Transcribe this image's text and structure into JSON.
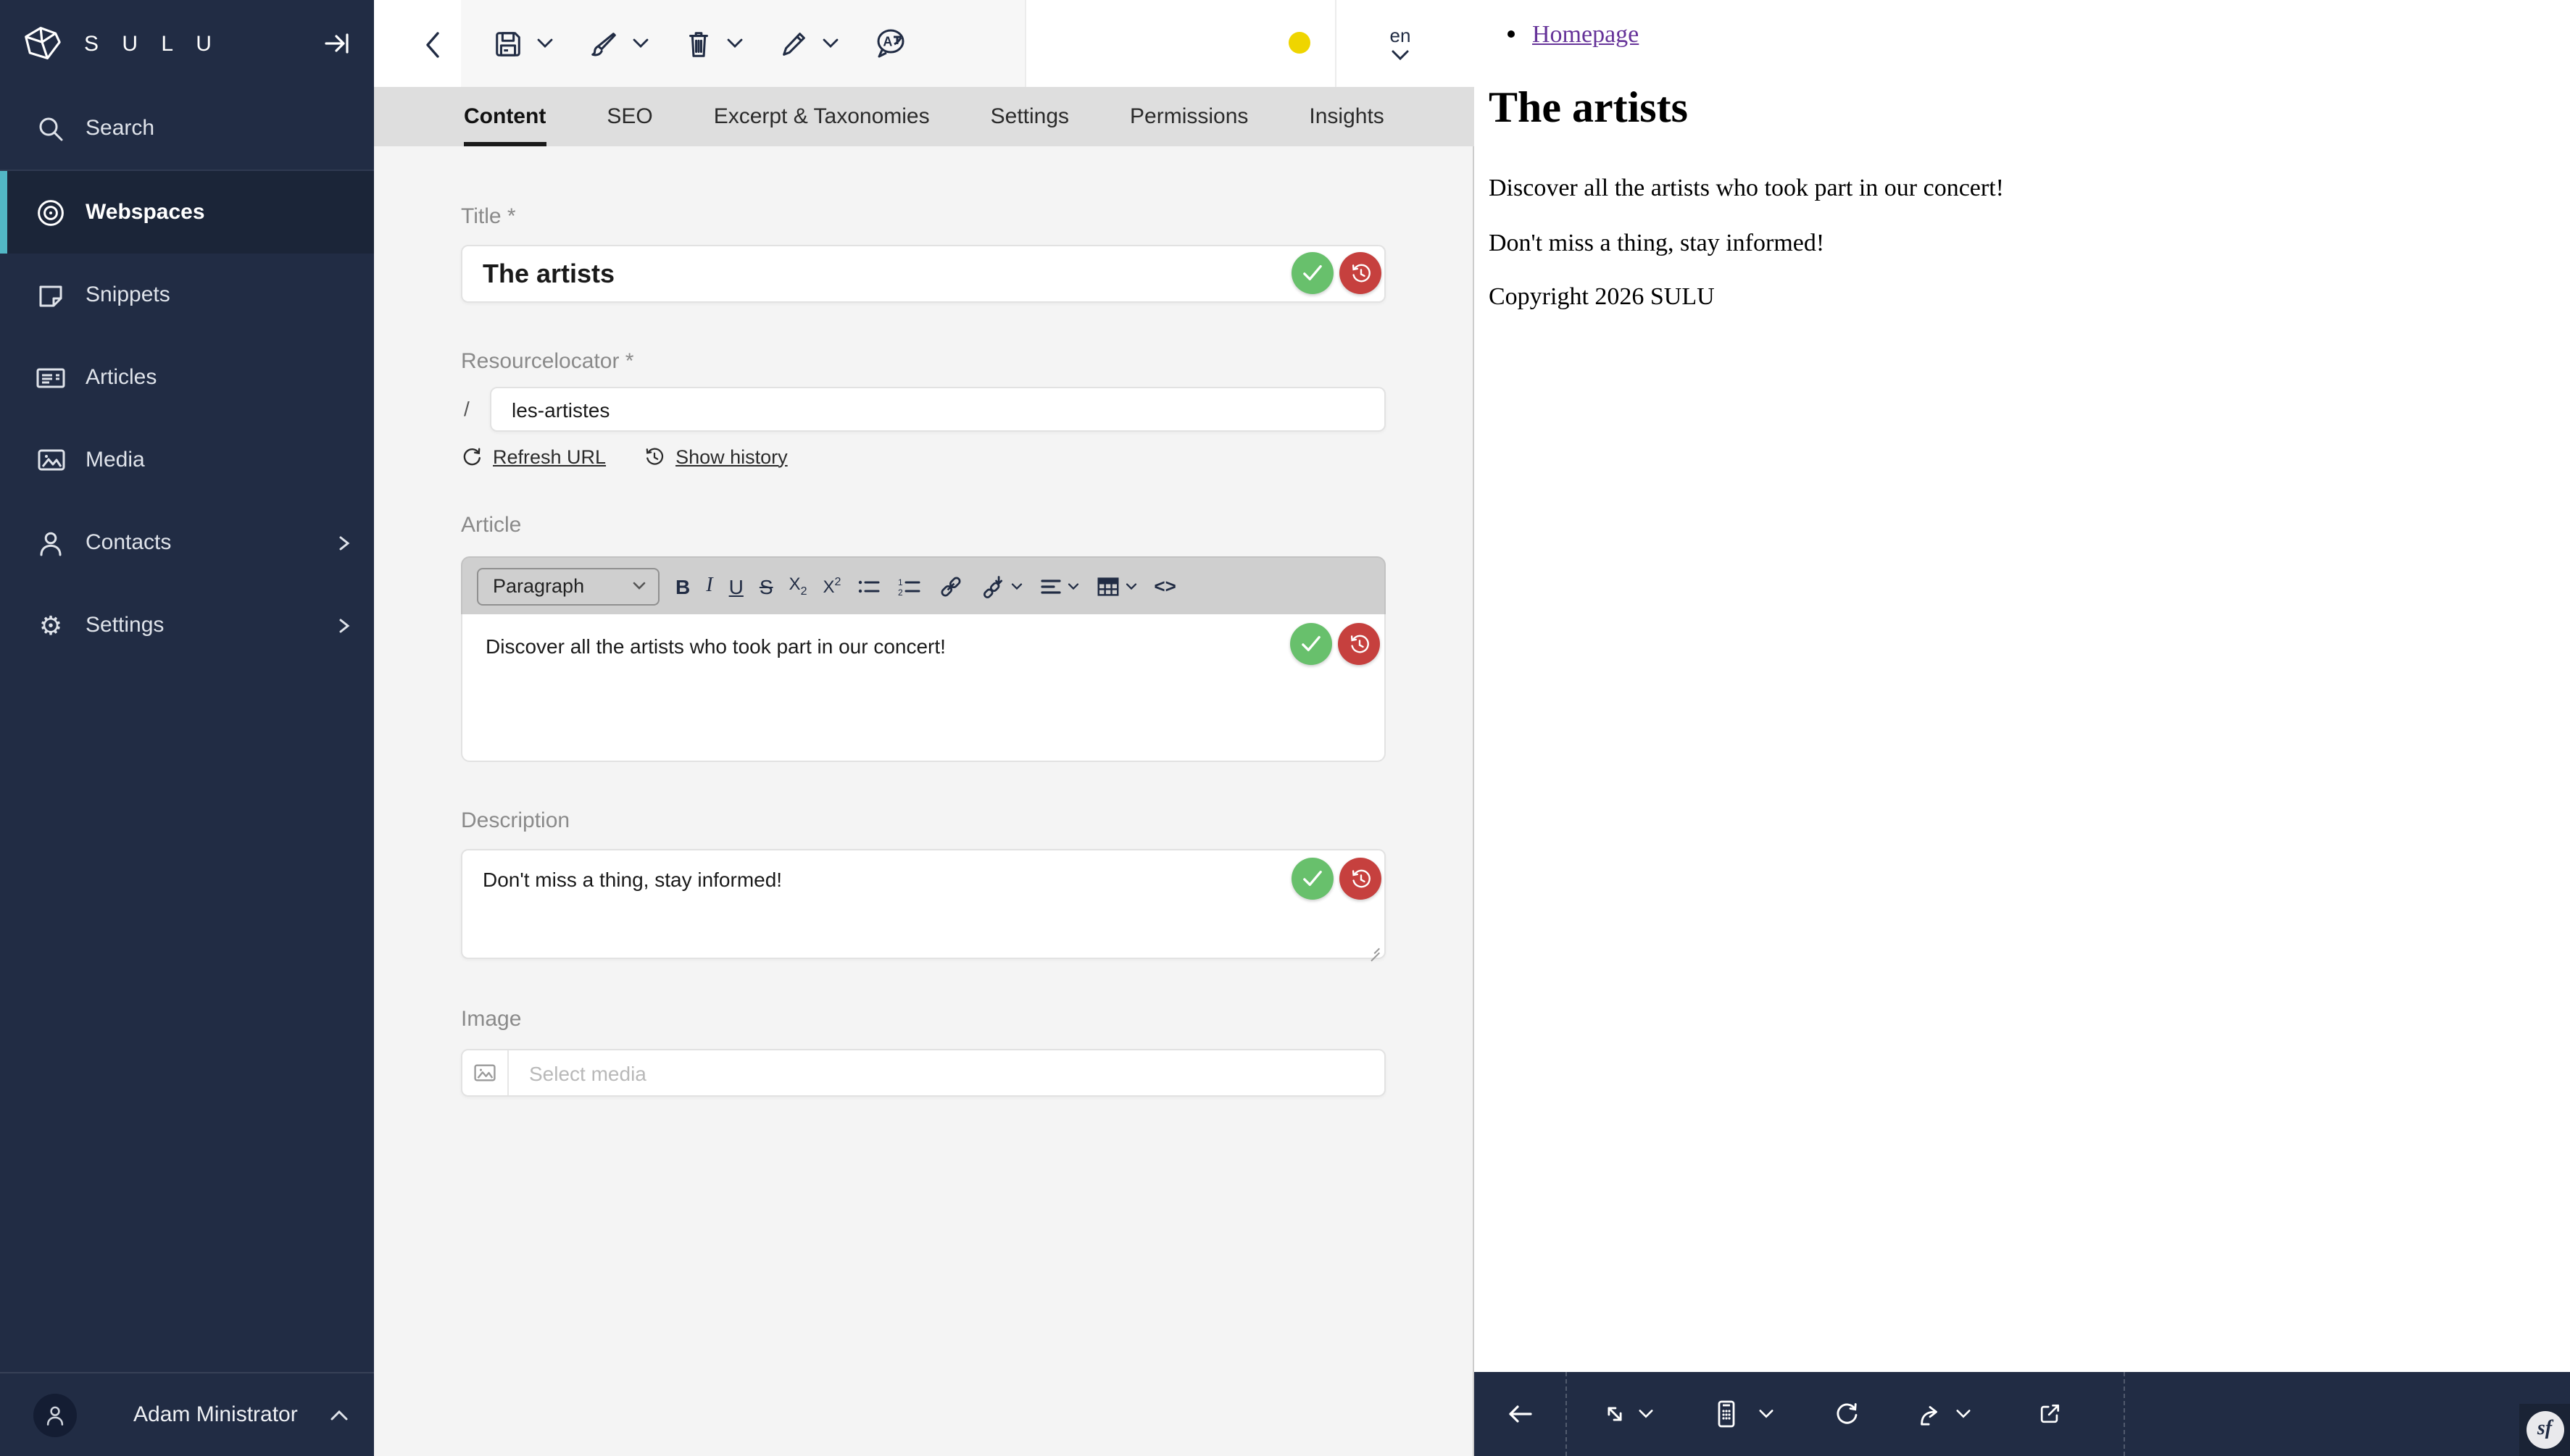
{
  "app": {
    "logo_text": "S U L U"
  },
  "colors": {
    "sidebar_navy": "#212c44",
    "accent_teal": "#52b7c5",
    "status_yellow": "#efd500",
    "confirm_green": "#68c06c",
    "revert_red": "#c6403e",
    "preview_link_purple": "#663399"
  },
  "sidebar": {
    "items": [
      {
        "label": "Search",
        "icon": "search-icon"
      },
      {
        "label": "Webspaces",
        "icon": "webspaces-icon",
        "active": true
      },
      {
        "label": "Snippets",
        "icon": "snippets-icon"
      },
      {
        "label": "Articles",
        "icon": "articles-icon"
      },
      {
        "label": "Media",
        "icon": "media-icon"
      },
      {
        "label": "Contacts",
        "icon": "contacts-icon",
        "has_children": true
      },
      {
        "label": "Settings",
        "icon": "settings-icon",
        "has_children": true
      }
    ],
    "user": {
      "name": "Adam Ministrator"
    }
  },
  "topbar": {
    "icons": [
      "save-icon",
      "brush-icon",
      "trash-icon",
      "pencil-icon",
      "translate-icon"
    ],
    "locale": "en"
  },
  "tabs": [
    {
      "label": "Content",
      "active": true
    },
    {
      "label": "SEO"
    },
    {
      "label": "Excerpt & Taxonomies"
    },
    {
      "label": "Settings"
    },
    {
      "label": "Permissions"
    },
    {
      "label": "Insights"
    }
  ],
  "form": {
    "title": {
      "label": "Title *",
      "value": "The artists"
    },
    "resourcelocator": {
      "label": "Resourcelocator *",
      "prefix": "/",
      "value": "les-artistes",
      "refresh_label": "Refresh URL",
      "history_label": "Show history"
    },
    "article": {
      "label": "Article",
      "block_style": "Paragraph",
      "value": "Discover all the artists who took part in our concert!"
    },
    "description": {
      "label": "Description",
      "value": "Don't miss a thing, stay informed!"
    },
    "image": {
      "label": "Image",
      "placeholder": "Select media"
    }
  },
  "editor_toolbar": {
    "bold": "B",
    "italic": "I",
    "underline": "U",
    "strikethrough": "S",
    "subscript": {
      "base": "X",
      "script": "2"
    },
    "superscript": {
      "base": "X",
      "script": "2"
    },
    "code": "<>"
  },
  "preview": {
    "nav_link": "Homepage",
    "heading": "The artists",
    "paragraphs": [
      "Discover all the artists who took part in our concert!",
      "Don't miss a thing, stay informed!",
      "Copyright 2026 SULU"
    ],
    "profiler_logo": "sf"
  },
  "icons_glyphs": {
    "search-icon": "magnifier",
    "webspaces-icon": "concentric-circles",
    "snippets-icon": "note",
    "articles-icon": "newspaper",
    "media-icon": "picture",
    "contacts-icon": "person",
    "settings-icon": "⚙",
    "collapse-sidebar-icon": "⇥",
    "back-icon": "‹",
    "save-icon": "floppy",
    "brush-icon": "paintbrush",
    "trash-icon": "trashcan",
    "pencil-icon": "pencil",
    "translate-icon": "speech-bubble-A",
    "check-icon": "✓",
    "history-icon": "clock-arrow",
    "refresh-icon": "⟳",
    "arrow-left-icon": "←",
    "resize-icon": "⤡",
    "device-icon": "phone-keypad",
    "share-icon": "curved-arrow",
    "external-link-icon": "box-arrow"
  }
}
